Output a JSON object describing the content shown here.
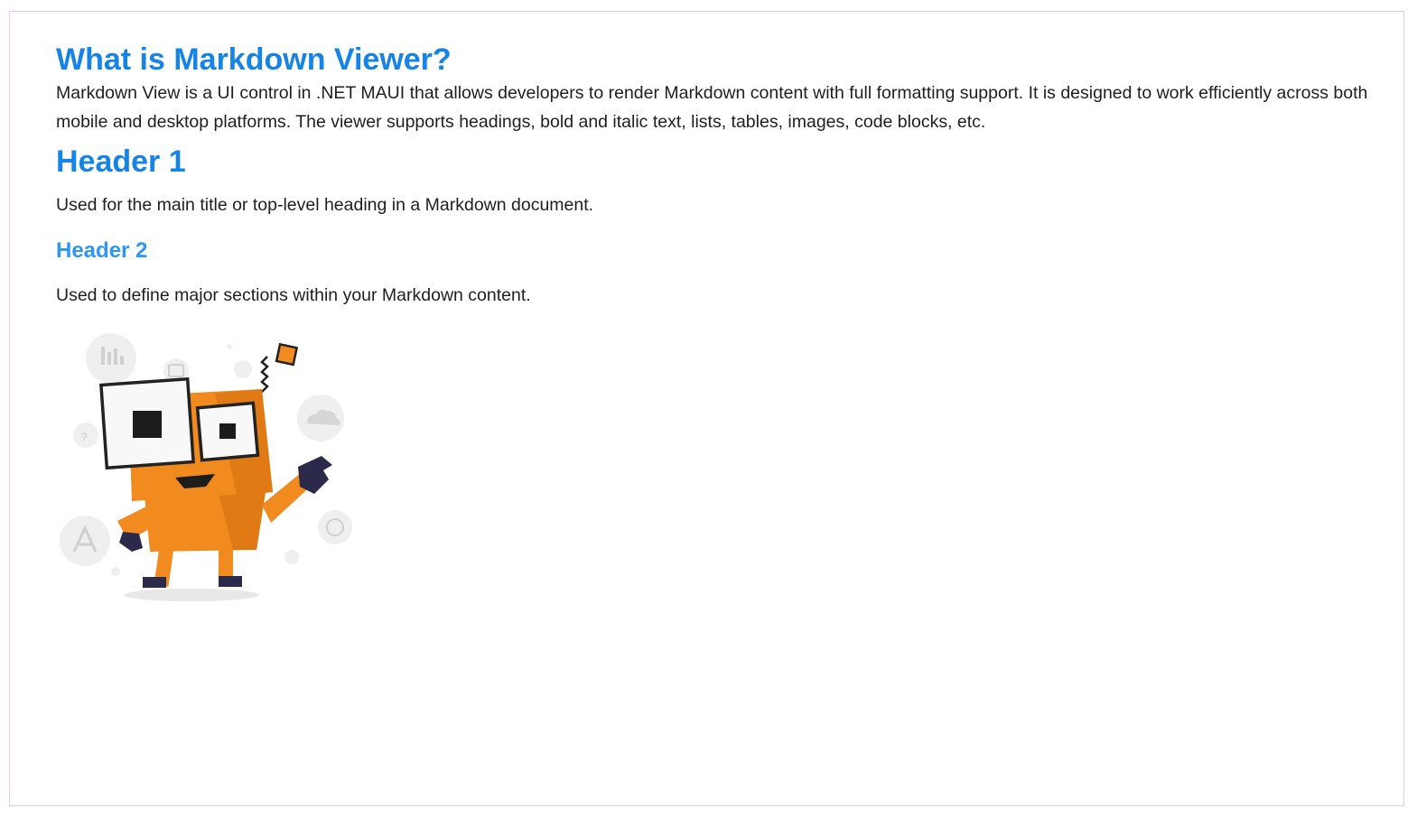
{
  "markdown": {
    "title": "What is Markdown Viewer?",
    "intro": "Markdown View is a UI control in .NET MAUI that allows developers to render Markdown content with full formatting support. It is designed to work efficiently across both mobile and desktop platforms. The viewer supports headings, bold and italic text, lists, tables, images, code blocks, etc.",
    "header1": "Header 1",
    "header1_text": "Used for the main title or top-level heading in a Markdown document.",
    "header2": "Header 2",
    "header2_text": "Used to define major sections within your Markdown content.",
    "image": {
      "icon": "robot-mascot-illustration"
    }
  },
  "colors": {
    "heading": "#1584e6",
    "subheading": "#2e97ef",
    "body_text": "#1f1f1f",
    "border": "#e3c9e3",
    "robot_orange": "#f28b1f",
    "robot_dark": "#2b2a4a"
  }
}
